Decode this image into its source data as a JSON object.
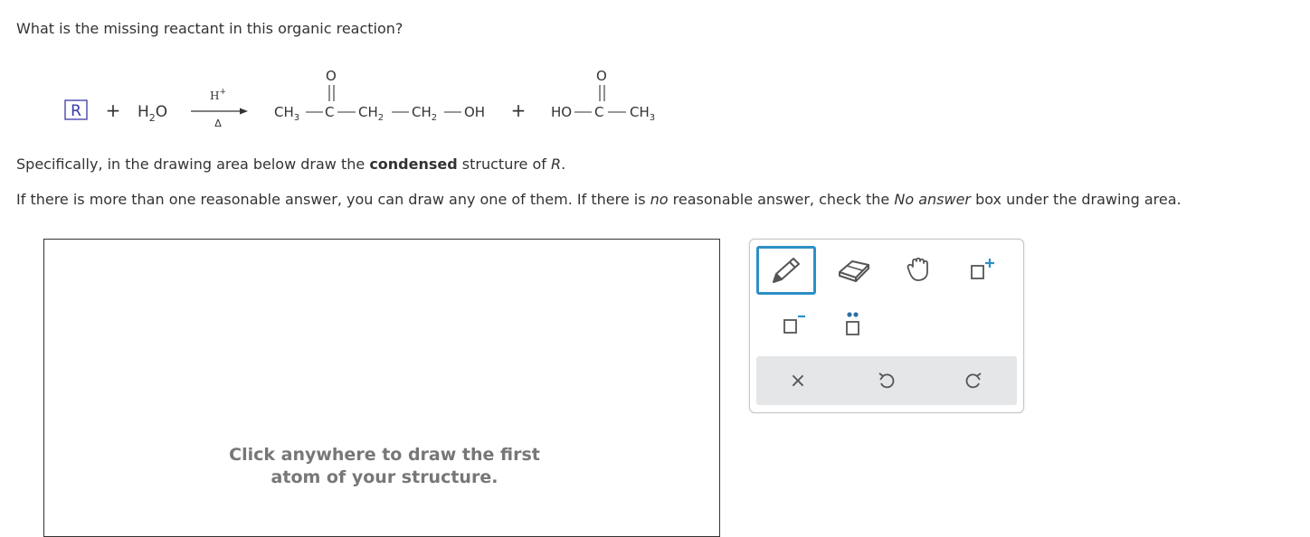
{
  "question": {
    "prompt": "What is the missing reactant in this organic reaction?"
  },
  "reaction": {
    "reactant_box": "R",
    "plus1": "+",
    "water_H": "H",
    "water_sub": "2",
    "water_O": "O",
    "catalyst_H": "H",
    "catalyst_charge": "+",
    "heat": "Δ",
    "product1": {
      "ch3": "CH",
      "ch3_sub": "3",
      "c": "C",
      "o": "O",
      "ch2a": "CH",
      "ch2a_sub": "2",
      "ch2b": "CH",
      "ch2b_sub": "2",
      "oh": "OH"
    },
    "plus2": "+",
    "product2": {
      "ho": "HO",
      "c": "C",
      "o": "O",
      "ch3": "CH",
      "ch3_sub": "3"
    }
  },
  "instructions": {
    "spec_prefix": "Specifically, in the drawing area below draw the ",
    "spec_bold": "condensed",
    "spec_mid": " structure of ",
    "spec_italic": "R",
    "spec_end": ".",
    "multi_prefix": "If there is more than one reasonable answer, you can draw any one of them. If there is ",
    "multi_italic1": "no",
    "multi_mid": " reasonable answer, check the ",
    "multi_italic2": "No answer",
    "multi_end": " box under the drawing area."
  },
  "drawing_area": {
    "hint_line1": "Click anywhere to draw the first",
    "hint_line2": "atom of your structure."
  },
  "toolbar": {
    "tools": [
      "pencil-icon",
      "eraser-icon",
      "hand-icon",
      "add-positive-charge-icon",
      "add-negative-charge-icon",
      "add-lone-pair-icon"
    ],
    "active_tool": "pencil-icon",
    "clear_label": "×",
    "accent_color": "#2d8fc6"
  }
}
